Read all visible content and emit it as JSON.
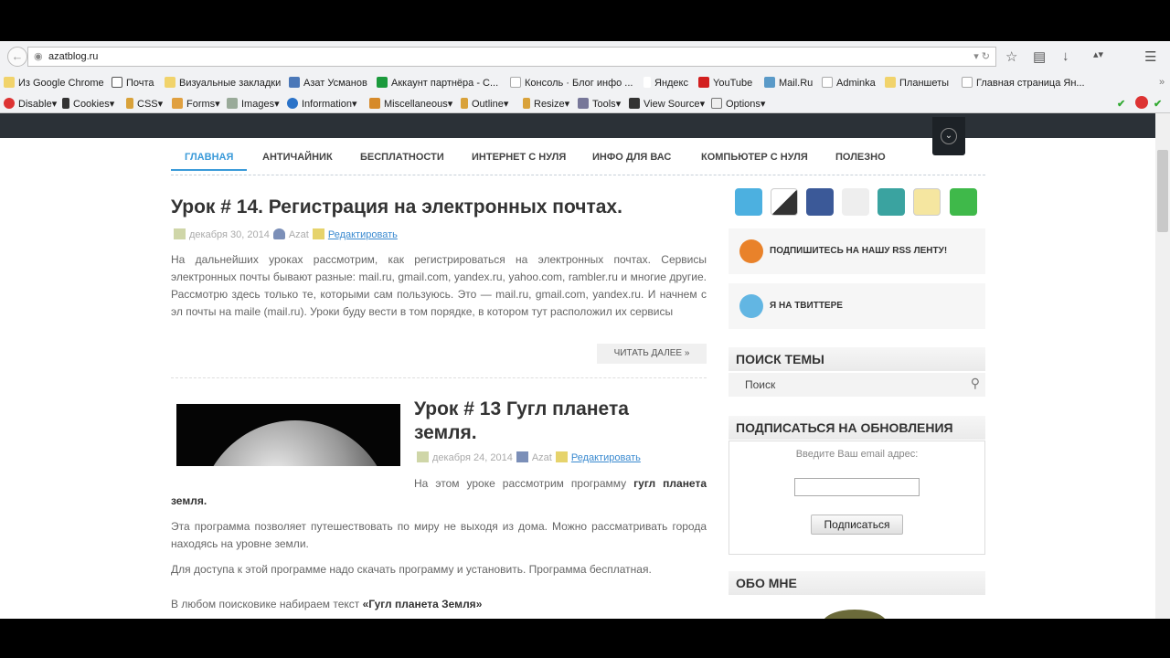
{
  "browser": {
    "url": "azatblog.ru",
    "bookmarks": [
      "Из Google Chrome",
      "Почта",
      "Визуальные закладки",
      "Азат Усманов",
      "Аккаунт партнёра - С...",
      "Консоль · Блог инфо ...",
      "Яндекс",
      "YouTube",
      "Mail.Ru",
      "Adminka",
      "Планшеты",
      "Главная страница Ян..."
    ],
    "addons": [
      "Disable",
      "Cookies",
      "CSS",
      "Forms",
      "Images",
      "Information",
      "Miscellaneous",
      "Outline",
      "Resize",
      "Tools",
      "View Source",
      "Options"
    ],
    "overflow": "»"
  },
  "nav": [
    "ГЛАВНАЯ",
    "АНТИЧАЙНИК",
    "БЕСПЛАТНОСТИ",
    "ИНТЕРНЕТ С НУЛЯ",
    "ИНФО ДЛЯ ВАС",
    "КОМПЬЮТЕР С НУЛЯ",
    "ПОЛЕЗНО"
  ],
  "post1": {
    "title": "Урок # 14. Регистрация на электронных почтах.",
    "date": "декабря 30, 2014",
    "author": "Azat",
    "edit": "Редактировать",
    "text": "На дальнейших уроках рассмотрим, как регистрироваться на электронных почтах. Сервисы электронных почты бывают разные: mail.ru, gmail.com, yandex.ru, yahoo.com, rambler.ru и многие другие. Рассмотрю здесь только те, которыми сам пользуюсь. Это — mail.ru, gmail.com, yandex.ru. И начнем с эл почты на mailе (mail.ru). Уроки буду вести в том порядке, в котором тут расположил их сервисы",
    "more": "ЧИТАТЬ ДАЛЕЕ »"
  },
  "post2": {
    "title": "Урок # 13 Гугл планета земля.",
    "date": "декабря 24, 2014",
    "author": "Azat",
    "edit": "Редактировать",
    "p1_pre": "На этом уроке рассмотрим программу ",
    "p1_bold": "гугл планета земля.",
    "p2": "Эта программа позволяет путешествовать по миру не выходя из дома. Можно рассматривать города находясь на уровне земли.",
    "p3": "Для доступа к этой программе надо скачать программу и установить. Программа бесплатная.",
    "p4_pre": "В любом поисковике набираем текст ",
    "p4_bold": "«Гугл планета Земля»"
  },
  "sidebar": {
    "rss": "ПОДПИШИТЕСЬ НА НАШУ RSS ЛЕНТУ!",
    "twitter": "Я НА ТВИТТЕРЕ",
    "search_title": "ПОИСК ТЕМЫ",
    "search_placeholder": "Поиск",
    "subscribe_title": "ПОДПИСАТЬСЯ НА ОБНОВЛЕНИЯ",
    "email_label": "Введите Ваш email адрес:",
    "subscribe_btn": "Подписаться",
    "about": "ОБО МНЕ"
  }
}
